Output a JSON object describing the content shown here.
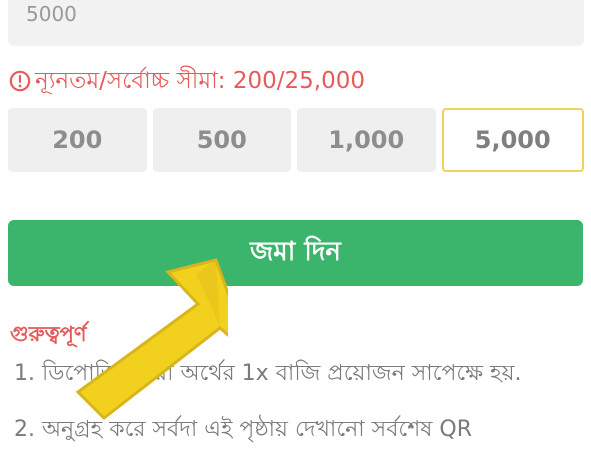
{
  "amount_input": {
    "value": "5000"
  },
  "limit": {
    "text": "ন্যূনতম/সর্বোচ্চ সীমা: 200/25,000"
  },
  "chips": [
    "200",
    "500",
    "1,000",
    "5,000"
  ],
  "selected_chip": "5,000",
  "submit": {
    "label": "জমা দিন"
  },
  "notes": {
    "title": "গুরুত্বপূর্ণ",
    "items": [
      "1. ডিপোজিট করা অর্থের 1x বাজি প্রয়োজন সাপেক্ষে হয়.",
      "2. অনুগ্রহ করে সর্বদা এই পৃষ্ঠায় দেখানো সর্বশেষ QR"
    ]
  },
  "colors": {
    "accent_green": "#3ab56b",
    "warning_red": "#e85a5a",
    "selected_border": "#f1d15a",
    "pointer_yellow": "#f2d11e"
  }
}
